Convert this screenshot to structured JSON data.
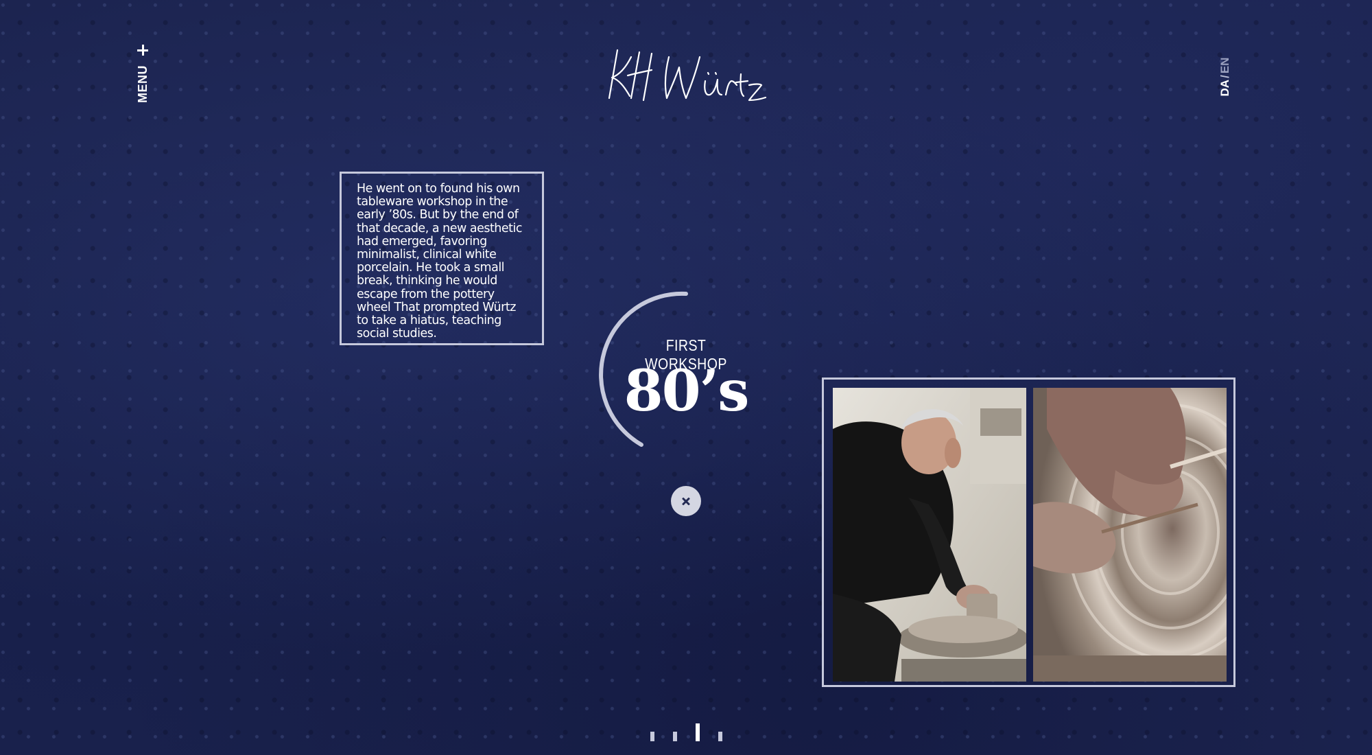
{
  "header": {
    "menu_label": "MENU",
    "menu_icon": "plus-icon",
    "logo_icon": "signature-logo",
    "language": {
      "da": "DA",
      "separator": "/",
      "en": "EN",
      "active": "DA"
    }
  },
  "story": {
    "text": "He went on to found his own tableware workshop in the early ’80s. But by the end of that decade, a new aesthetic had emerged, favoring minimalist, clinical white porcelain. He took a small break, thinking he would escape from the pottery wheel  That prompted Würtz to take a hiatus, teaching social studies."
  },
  "timeline": {
    "label": "FIRST WORKSHOP",
    "year": "80’s",
    "close_icon": "close-icon"
  },
  "pagination": {
    "count": 4,
    "active_index": 2
  },
  "colors": {
    "background": "#1c2450",
    "frame": "#c6c9dc",
    "text": "#ffffff"
  }
}
